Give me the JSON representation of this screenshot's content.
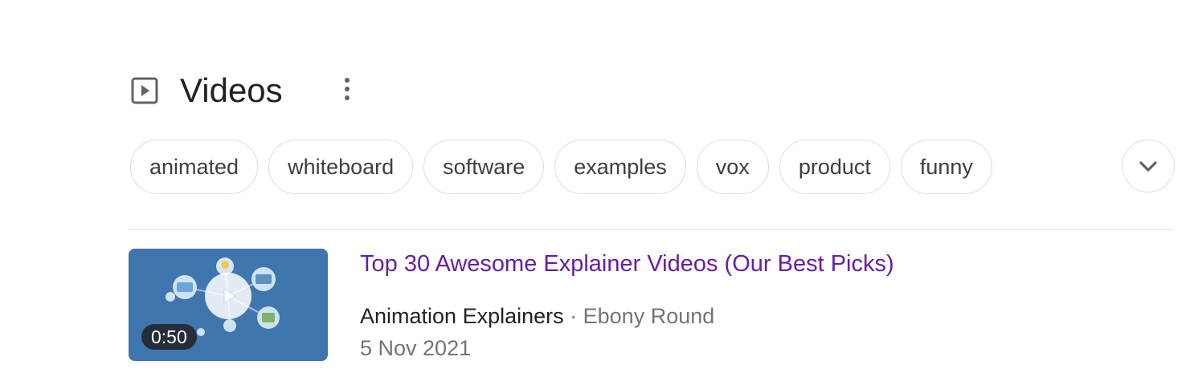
{
  "section": {
    "title": "Videos",
    "icon": "video-play-box-icon"
  },
  "chips": [
    {
      "label": "animated"
    },
    {
      "label": "whiteboard"
    },
    {
      "label": "software"
    },
    {
      "label": "examples"
    },
    {
      "label": "vox"
    },
    {
      "label": "product"
    },
    {
      "label": "funny"
    }
  ],
  "results": [
    {
      "title": "Top 30 Awesome Explainer Videos (Our Best Picks)",
      "duration": "0:50",
      "channel": "Animation Explainers",
      "separator": " · ",
      "author": "Ebony Round",
      "date": "5 Nov 2021"
    }
  ],
  "colors": {
    "link_visited": "#681da8",
    "chip_border": "#dadce0",
    "muted_text": "#70757a",
    "thumbnail_bg": "#3f76ad"
  }
}
